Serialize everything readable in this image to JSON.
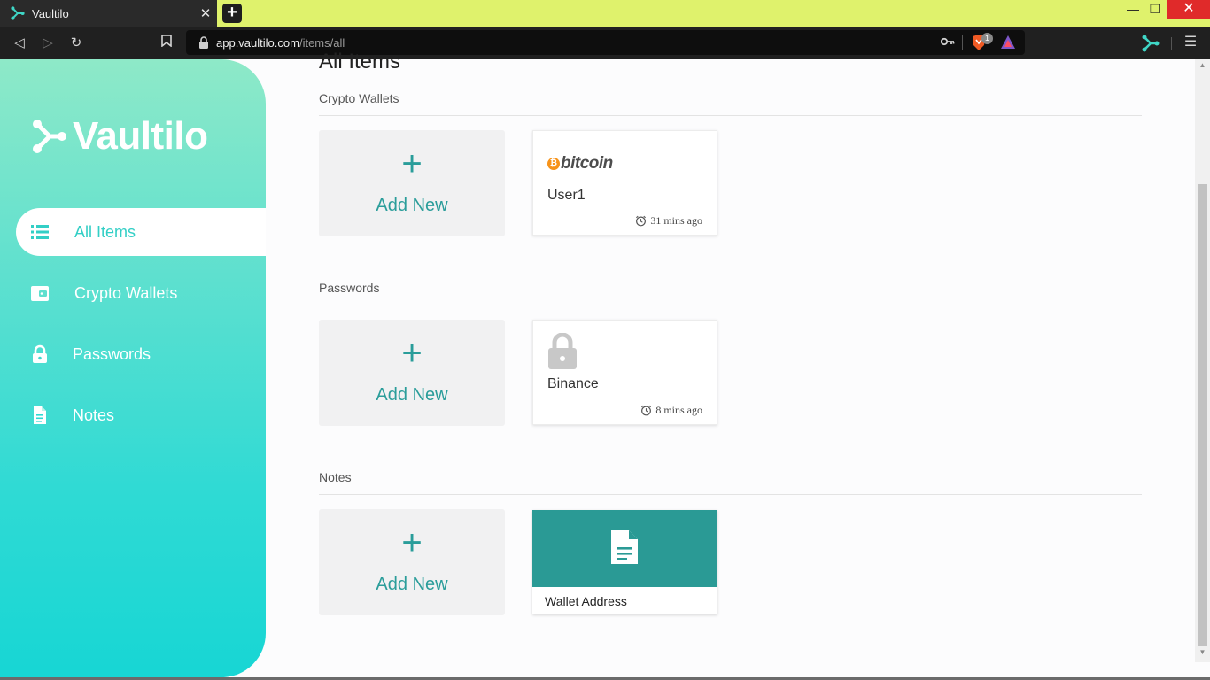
{
  "browser": {
    "tab_title": "Vaultilo",
    "tab_close": "✕",
    "new_tab": "+",
    "url_domain": "app.vaultilo.com",
    "url_path": "/items/all",
    "shield_count": "1",
    "controls": {
      "minimize": "—",
      "maximize": "❐",
      "close": "✕"
    },
    "nav": {
      "back": "◁",
      "forward": "▷",
      "reload": "↻",
      "bookmark": "🔖",
      "menu": "☰",
      "key": "🔑"
    }
  },
  "sidebar": {
    "logo_text": "Vaultilo",
    "items": [
      {
        "label": "All Items",
        "icon": "list-icon",
        "active": true
      },
      {
        "label": "Crypto Wallets",
        "icon": "wallet-icon",
        "active": false
      },
      {
        "label": "Passwords",
        "icon": "lock-icon",
        "active": false
      },
      {
        "label": "Notes",
        "icon": "document-icon",
        "active": false
      }
    ]
  },
  "main": {
    "heading": "All Items",
    "add_plus": "+",
    "sections": [
      {
        "title": "Crypto Wallets",
        "add_label": "Add New",
        "items": [
          {
            "brand": "bitcoin",
            "name": "User1",
            "time": "31 mins ago"
          }
        ]
      },
      {
        "title": "Passwords",
        "add_label": "Add New",
        "items": [
          {
            "name": "Binance",
            "time": "8 mins ago"
          }
        ]
      },
      {
        "title": "Notes",
        "add_label": "Add New",
        "items": [
          {
            "name": "Wallet Address"
          }
        ]
      }
    ]
  },
  "colors": {
    "accent": "#2a9d9a",
    "sidebar_top": "#8ee9c8",
    "sidebar_bottom": "#17d6d4",
    "active_text": "#33cfc6",
    "titlebar": "#dff26c"
  }
}
